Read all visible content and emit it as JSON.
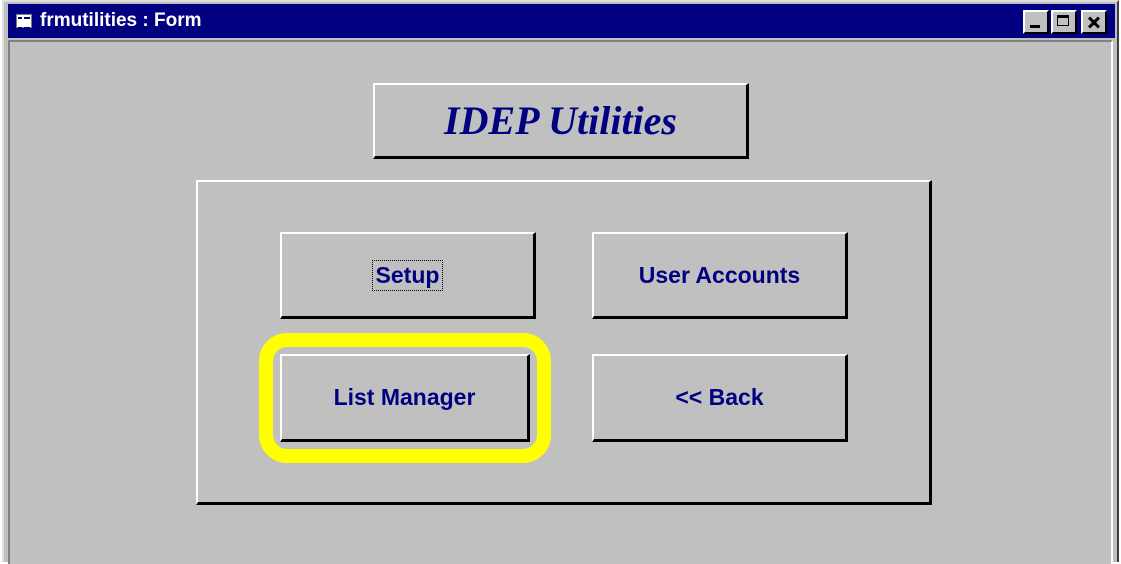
{
  "window": {
    "title": "frmutilities : Form",
    "icon": "form-icon",
    "controls": [
      "minimize-icon",
      "maximize-icon",
      "close-icon"
    ]
  },
  "form": {
    "heading": "IDEP Utilities",
    "buttons": {
      "setup": "Setup",
      "user_accounts": "User Accounts",
      "list_manager": "List Manager",
      "back": "<< Back"
    },
    "focused_button": "Setup",
    "highlighted_button": "List Manager"
  },
  "colors": {
    "titlebar": "#000080",
    "face": "#c0c0c0",
    "button_text": "#000080",
    "highlight": "#ffff00"
  }
}
